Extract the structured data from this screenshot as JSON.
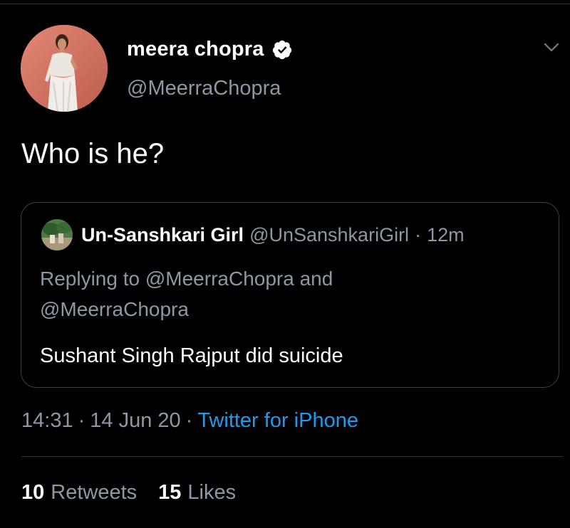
{
  "colors": {
    "background": "#000000",
    "text_primary": "#ffffff",
    "text_secondary": "#8b98a5",
    "link": "#1d9bf0",
    "verified_badge": "#ffffff",
    "border": "#3d4246"
  },
  "author": {
    "display_name": "meera chopra",
    "handle": "@MeerraChopra",
    "verified": true,
    "avatar_icon": "profile-photo",
    "verified_icon": "verified-badge-icon"
  },
  "menu": {
    "icon": "chevron-down-icon"
  },
  "tweet": {
    "text": "Who is he?"
  },
  "quoted_tweet": {
    "display_name": "Un-Sanshkari Girl",
    "handle": "@UnSanshkariGirl",
    "separator": "·",
    "time": "12m",
    "replying_line1": "Replying to @MeerraChopra and",
    "replying_line2": "@MeerraChopra",
    "text": "Sushant Singh Rajput did suicide",
    "avatar_icon": "profile-photo"
  },
  "meta": {
    "time": "14:31",
    "sep1": "·",
    "date": "14 Jun 20",
    "sep2": "·",
    "client": "Twitter for iPhone"
  },
  "stats": {
    "retweets_count": "10",
    "retweets_label": "Retweets",
    "likes_count": "15",
    "likes_label": "Likes"
  }
}
